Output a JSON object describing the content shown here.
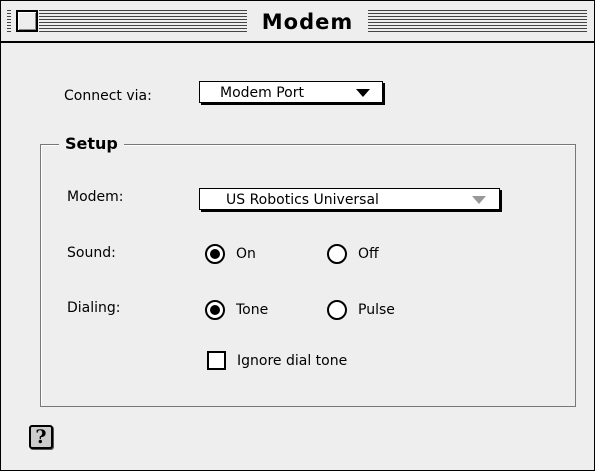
{
  "window": {
    "title": "Modem"
  },
  "connect_via": {
    "label": "Connect via:",
    "selected": "Modem Port"
  },
  "setup": {
    "title": "Setup",
    "modem": {
      "label": "Modem:",
      "selected": "US Robotics Universal"
    },
    "sound": {
      "label": "Sound:",
      "options": [
        {
          "label": "On",
          "selected": true
        },
        {
          "label": "Off",
          "selected": false
        }
      ]
    },
    "dialing": {
      "label": "Dialing:",
      "options": [
        {
          "label": "Tone",
          "selected": true
        },
        {
          "label": "Pulse",
          "selected": false
        }
      ]
    },
    "ignore_dial_tone": {
      "label": "Ignore dial tone",
      "checked": false
    }
  },
  "help": {
    "glyph": "?"
  }
}
